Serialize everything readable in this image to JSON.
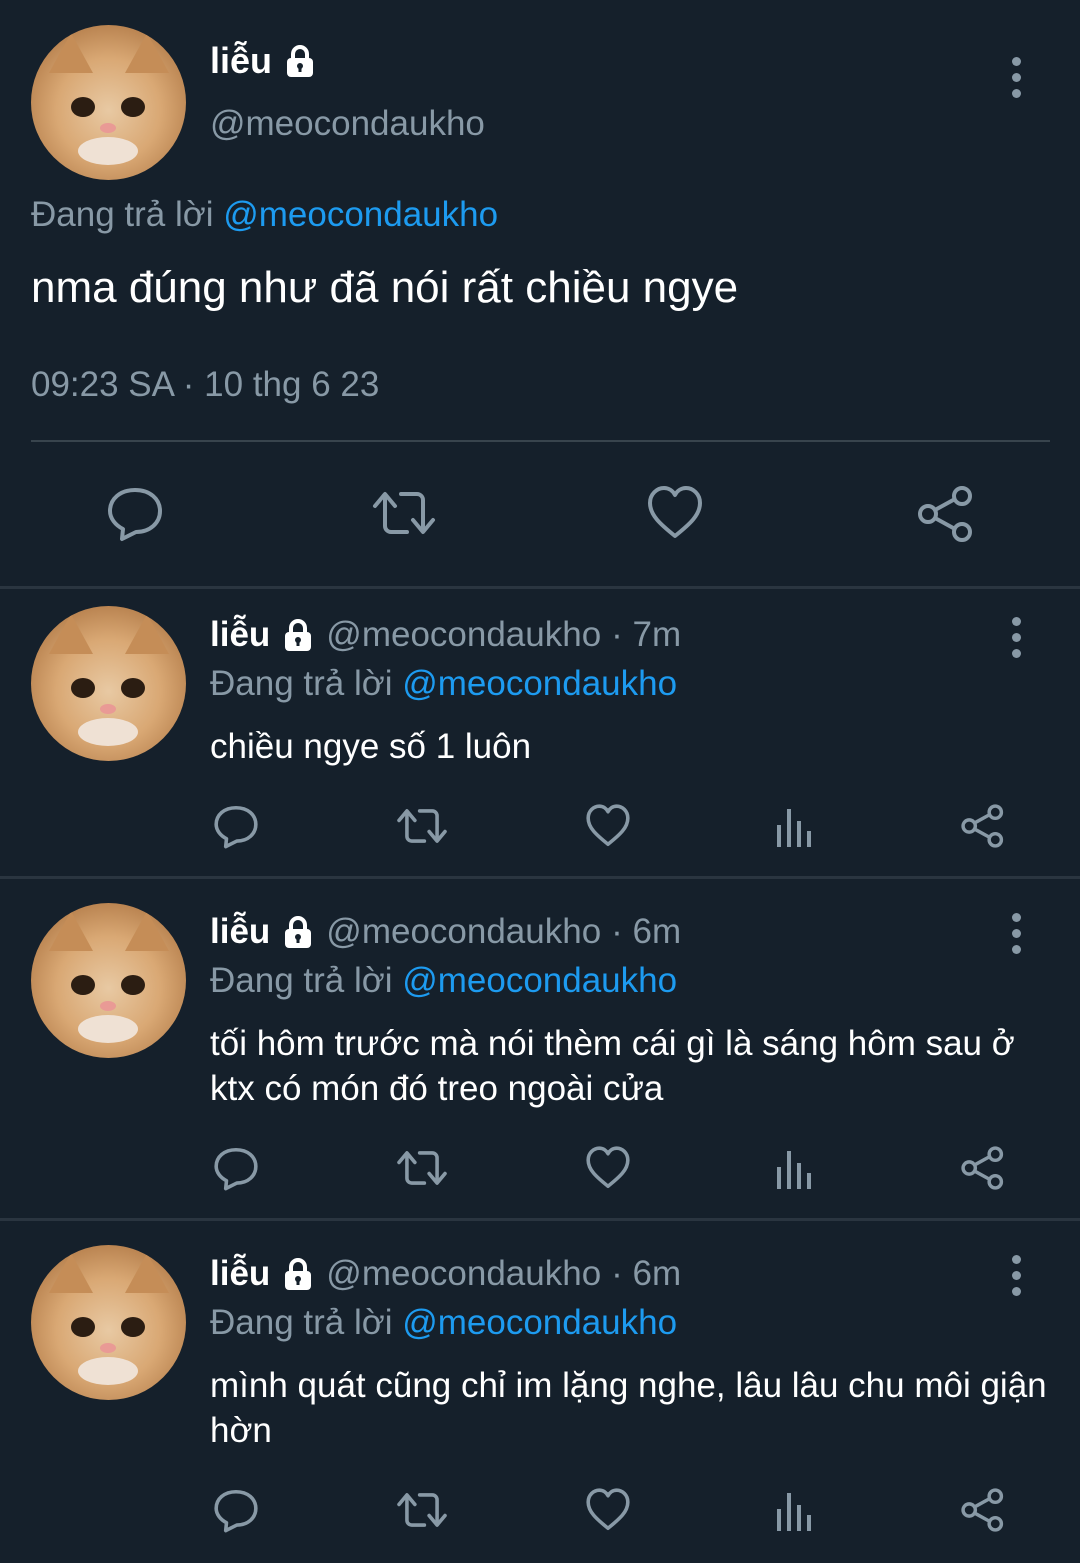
{
  "main_tweet": {
    "author_name": "liễu",
    "handle": "@meocondaukho",
    "replying_prefix": "Đang trả lời",
    "replying_to": "@meocondaukho",
    "text": "nma đúng như đã nói rất chiều ngye",
    "timestamp": "09:23 SA · 10 thg 6 23",
    "icons": [
      "reply-icon",
      "retweet-icon",
      "like-icon",
      "share-icon"
    ]
  },
  "replies": [
    {
      "author_name": "liễu",
      "handle": "@meocondaukho",
      "time": "· 7m",
      "replying_prefix": "Đang trả lời",
      "replying_to": "@meocondaukho",
      "text": "chiều ngye số 1 luôn"
    },
    {
      "author_name": "liễu",
      "handle": "@meocondaukho",
      "time": "· 6m",
      "replying_prefix": "Đang trả lời",
      "replying_to": "@meocondaukho",
      "text": "tối hôm trước mà nói thèm cái gì là sáng hôm sau ở ktx có món đó treo ngoài cửa"
    },
    {
      "author_name": "liễu",
      "handle": "@meocondaukho",
      "time": "· 6m",
      "replying_prefix": "Đang trả lời",
      "replying_to": "@meocondaukho",
      "text": "mình quát cũng chỉ im lặng nghe, lâu lâu chu môi giận hờn"
    }
  ],
  "colors": {
    "background": "#15202b",
    "text": "#ffffff",
    "muted": "#8899a6",
    "link": "#1d9bf0",
    "divider": "#38444d"
  }
}
